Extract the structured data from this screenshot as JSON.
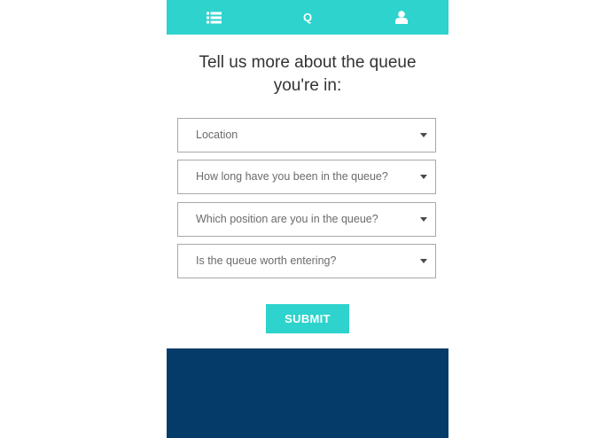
{
  "colors": {
    "accent": "#2dd3cc",
    "footer": "#043b68",
    "heading_text": "#333333",
    "field_text": "#6b6b6b",
    "field_border": "#a8a8a8"
  },
  "nav": {
    "items": [
      {
        "icon": "list-icon"
      },
      {
        "icon": "search-icon",
        "glyph": "Q"
      },
      {
        "icon": "user-icon"
      }
    ]
  },
  "form": {
    "heading_line1": "Tell us more about the queue",
    "heading_line2": "you're in:",
    "fields": [
      {
        "label": "Location"
      },
      {
        "label": "How long have you been in the queue?"
      },
      {
        "label": "Which position are you in the queue?"
      },
      {
        "label": "Is the queue worth entering?"
      }
    ],
    "submit_label": "SUBMIT"
  }
}
